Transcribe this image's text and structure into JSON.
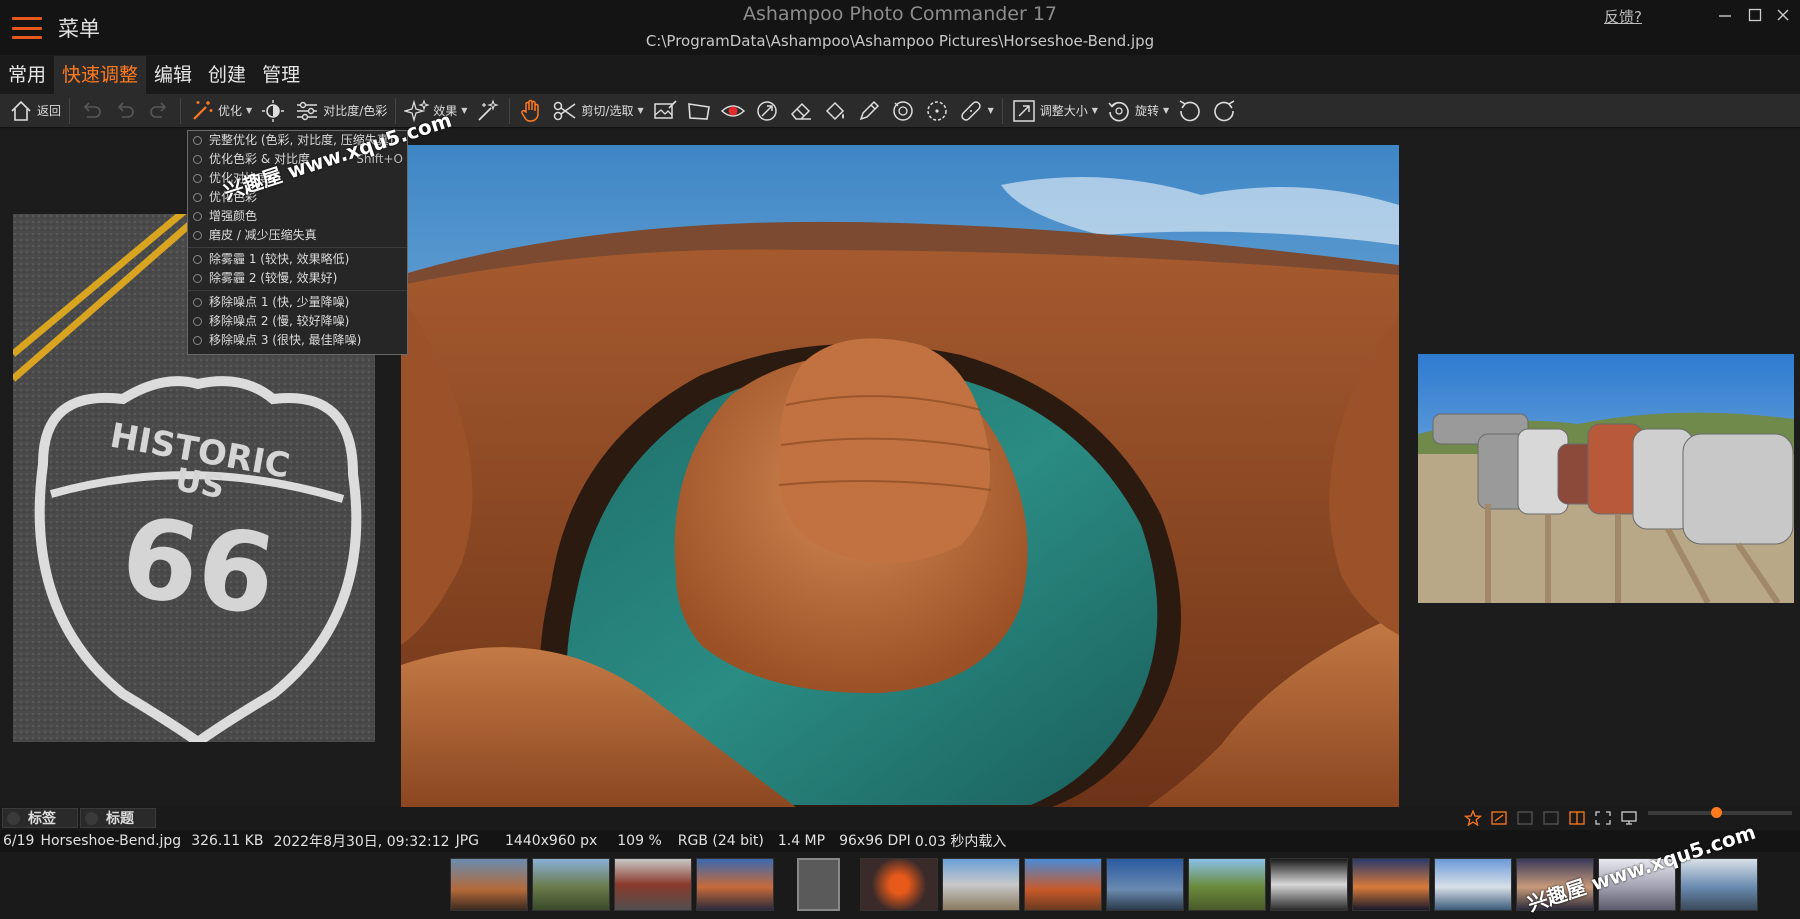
{
  "titlebar": {
    "menu_label": "菜单",
    "app_title": "Ashampoo Photo Commander 17",
    "file_path": "C:\\ProgramData\\Ashampoo\\Ashampoo Pictures\\Horseshoe-Bend.jpg",
    "feedback": "反馈?"
  },
  "tabs": [
    {
      "label": "常用",
      "active": false
    },
    {
      "label": "快速调整",
      "active": true
    },
    {
      "label": "编辑",
      "active": false
    },
    {
      "label": "创建",
      "active": false
    },
    {
      "label": "管理",
      "active": false
    }
  ],
  "toolbar": {
    "back": "返回",
    "optimize": "优化",
    "contrast": "对比度/色彩",
    "effects": "效果",
    "cut": "剪切/选取",
    "resize": "调整大小",
    "rotate": "旋转"
  },
  "optimize_menu": [
    {
      "label": "完整优化 (色彩, 对比度, 压缩失真)",
      "shortcut": ""
    },
    {
      "label": "优化色彩 & 对比度",
      "shortcut": "Shift+O"
    },
    {
      "label": "优化对比度",
      "shortcut": ""
    },
    {
      "label": "优化色彩",
      "shortcut": ""
    },
    {
      "label": "增强颜色",
      "shortcut": ""
    },
    {
      "label": "磨皮 / 减少压缩失真",
      "shortcut": ""
    },
    {
      "label": "除雾霾 1 (较快, 效果略低)",
      "shortcut": ""
    },
    {
      "label": "除雾霾 2 (较慢, 效果好)",
      "shortcut": ""
    },
    {
      "label": "移除噪点 1 (快, 少量降噪)",
      "shortcut": ""
    },
    {
      "label": "移除噪点 2 (慢, 较好降噪)",
      "shortcut": ""
    },
    {
      "label": "移除噪点 3 (很快, 最佳降噪)",
      "shortcut": ""
    }
  ],
  "images": {
    "left_sign_text": "HISTORIC",
    "left_sign_us": "US",
    "left_sign_number": "66"
  },
  "labelbar": {
    "tags": "标签",
    "title": "标题",
    "zoom_level": 0.47
  },
  "status": {
    "index": "6/19",
    "filename": "Horseshoe-Bend.jpg",
    "filesize": "326.11 KB",
    "date": "2022年8月30日, 09:32:12",
    "format": "JPG",
    "dimensions": "1440x960 px",
    "zoom": "109 %",
    "color": "RGB (24 bit)",
    "megapixels": "1.4 MP",
    "dpi": "96x96 DPI",
    "load_time": "0.03 秒内载入"
  },
  "watermark": {
    "text": "兴趣屋 www.xqu5.com"
  },
  "colors": {
    "accent": "#ff7a1e",
    "background": "#1a1a1a",
    "toolbar": "#2b2b2b"
  }
}
